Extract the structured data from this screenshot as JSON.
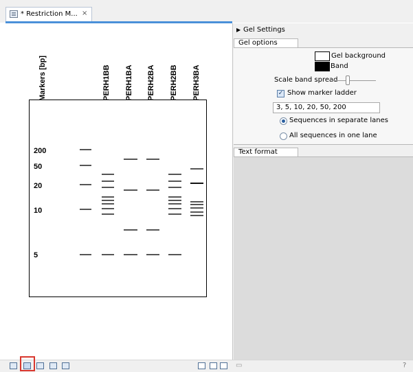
{
  "tab": {
    "title": "* Restriction M...",
    "close": "×",
    "icon": "gel-view-icon"
  },
  "gel": {
    "lane_labels": [
      "Markers [bp]",
      "PERH1BB",
      "PERH1BA",
      "PERH2BA",
      "PERH2BB",
      "PERH3BA"
    ],
    "ladder_labels": [
      "200",
      "50",
      "20",
      "10",
      "5"
    ]
  },
  "side_panel": {
    "header": "Gel Settings",
    "gel_options": {
      "tab_label": "Gel options",
      "gel_background_label": "Gel background",
      "band_label": "Band",
      "scale_band_spread_label": "Scale band spread",
      "show_marker_ladder_label": "Show marker ladder",
      "show_marker_ladder_checked": true,
      "marker_sizes": "3, 5, 10, 20, 50, 200",
      "sequences_separate_label": "Sequences in separate lanes",
      "all_sequences_one_lane_label": "All sequences in one lane",
      "selected_layout": "separate"
    },
    "text_format": {
      "tab_label": "Text format"
    },
    "help": "?"
  },
  "colors": {
    "gel_background": "#ffffff",
    "band": "#000000",
    "accent": "#4a90d9",
    "highlight": "#d8362d"
  }
}
